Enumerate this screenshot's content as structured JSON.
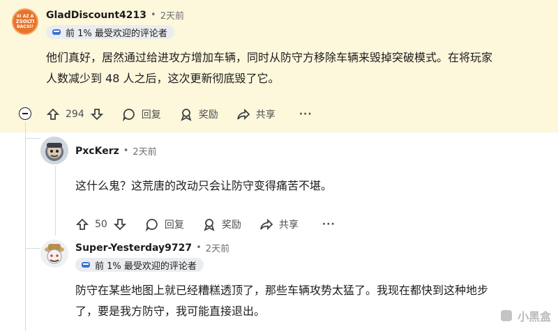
{
  "comments": [
    {
      "author": "GladDiscount4213",
      "separator": "•",
      "time": "2天前",
      "flair": "前 1% 最受欢迎的评论者",
      "avatar_text": [
        "XI AZ A",
        "ZSOLTI",
        "BACSI?"
      ],
      "body_lines": [
        "他们真好，居然通过给进攻方增加车辆，同时从防守方移除车辆来毁掉突破模式。在将玩家",
        "人数减少到 48 人之后，这次更新彻底毁了它。"
      ],
      "votes": "294",
      "reply_label": "回复",
      "award_label": "奖励",
      "share_label": "共享",
      "more_label": "···"
    },
    {
      "author": "PxcKerz",
      "separator": "•",
      "time": "2天前",
      "body_lines": [
        "这什么鬼？这荒唐的改动只会让防守变得痛苦不堪。"
      ],
      "votes": "50",
      "reply_label": "回复",
      "award_label": "奖励",
      "share_label": "共享",
      "more_label": "···"
    },
    {
      "author": "Super-Yesterday9727",
      "separator": "•",
      "time": "2天前",
      "flair": "前 1% 最受欢迎的评论者",
      "body_lines": [
        "防守在某些地图上就已经糟糕透顶了，那些车辆攻势太猛了。我现在都快到这种地步",
        "了，要是我方防守，我可能直接退出。"
      ]
    }
  ],
  "watermark": "小黑盒",
  "colors": {
    "highlight": "#fdf7dc",
    "avatar1": "#e8732a",
    "flair_bg": "#eaedef"
  }
}
